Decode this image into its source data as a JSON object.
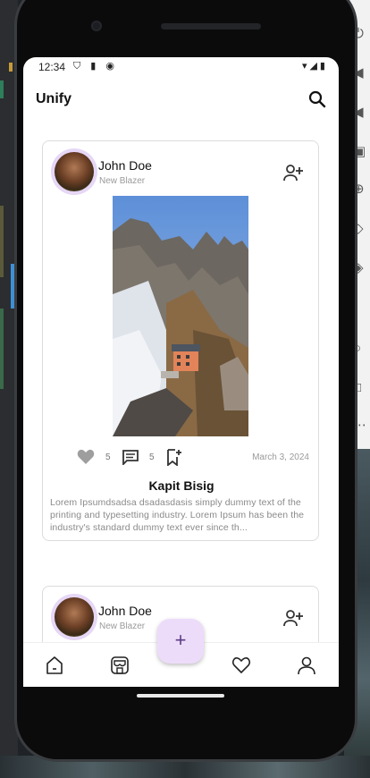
{
  "status_bar": {
    "time": "12:34"
  },
  "app": {
    "title": "Unify"
  },
  "posts": [
    {
      "author": "John Doe",
      "subtitle": "New Blazer",
      "likes": "5",
      "comments": "5",
      "date": "March 3, 2024",
      "title": "Kapit Bisig",
      "body": "Lorem Ipsumdsadsa dsadasdasis simply dummy text of the printing and typesetting industry. Lorem Ipsum has been the industry's standard dummy text ever since th..."
    },
    {
      "author": "John Doe",
      "subtitle": "New Blazer"
    }
  ],
  "fab": {
    "label": "+"
  },
  "colors": {
    "accent": "#ecdcfa",
    "avatar_ring": "#e6d7f6"
  },
  "icons": [
    "search-icon",
    "add-person-icon",
    "heart-icon",
    "comment-icon",
    "bookmark-add-icon",
    "home-icon",
    "store-icon",
    "favorite-icon",
    "profile-icon"
  ]
}
